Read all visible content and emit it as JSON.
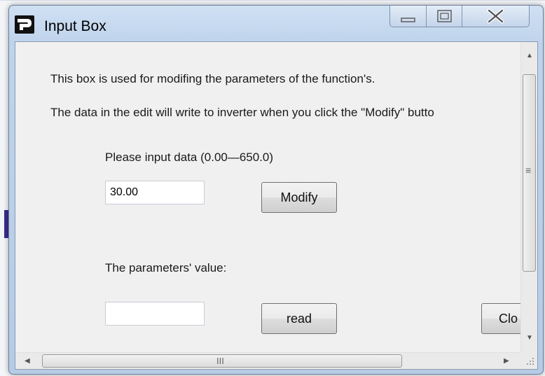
{
  "window": {
    "title": "Input Box",
    "minimize_icon": "minimize-icon",
    "maximize_icon": "maximize-icon",
    "close_icon": "close-icon"
  },
  "dialog": {
    "info_line1": "This box is used for modifing the parameters of the function's.",
    "info_line2": "The data in the edit will write to inverter when you click the \"Modify\" butto",
    "input_label": "Please input data (0.00—650.0)",
    "input_value": "30.00",
    "modify_label": "Modify",
    "value_label": "The parameters'  value:",
    "value_field": "",
    "read_label": "read",
    "close_label": "Clo"
  },
  "scrollbars": {
    "vertical_grip": "≡",
    "horizontal_grip": "III"
  }
}
